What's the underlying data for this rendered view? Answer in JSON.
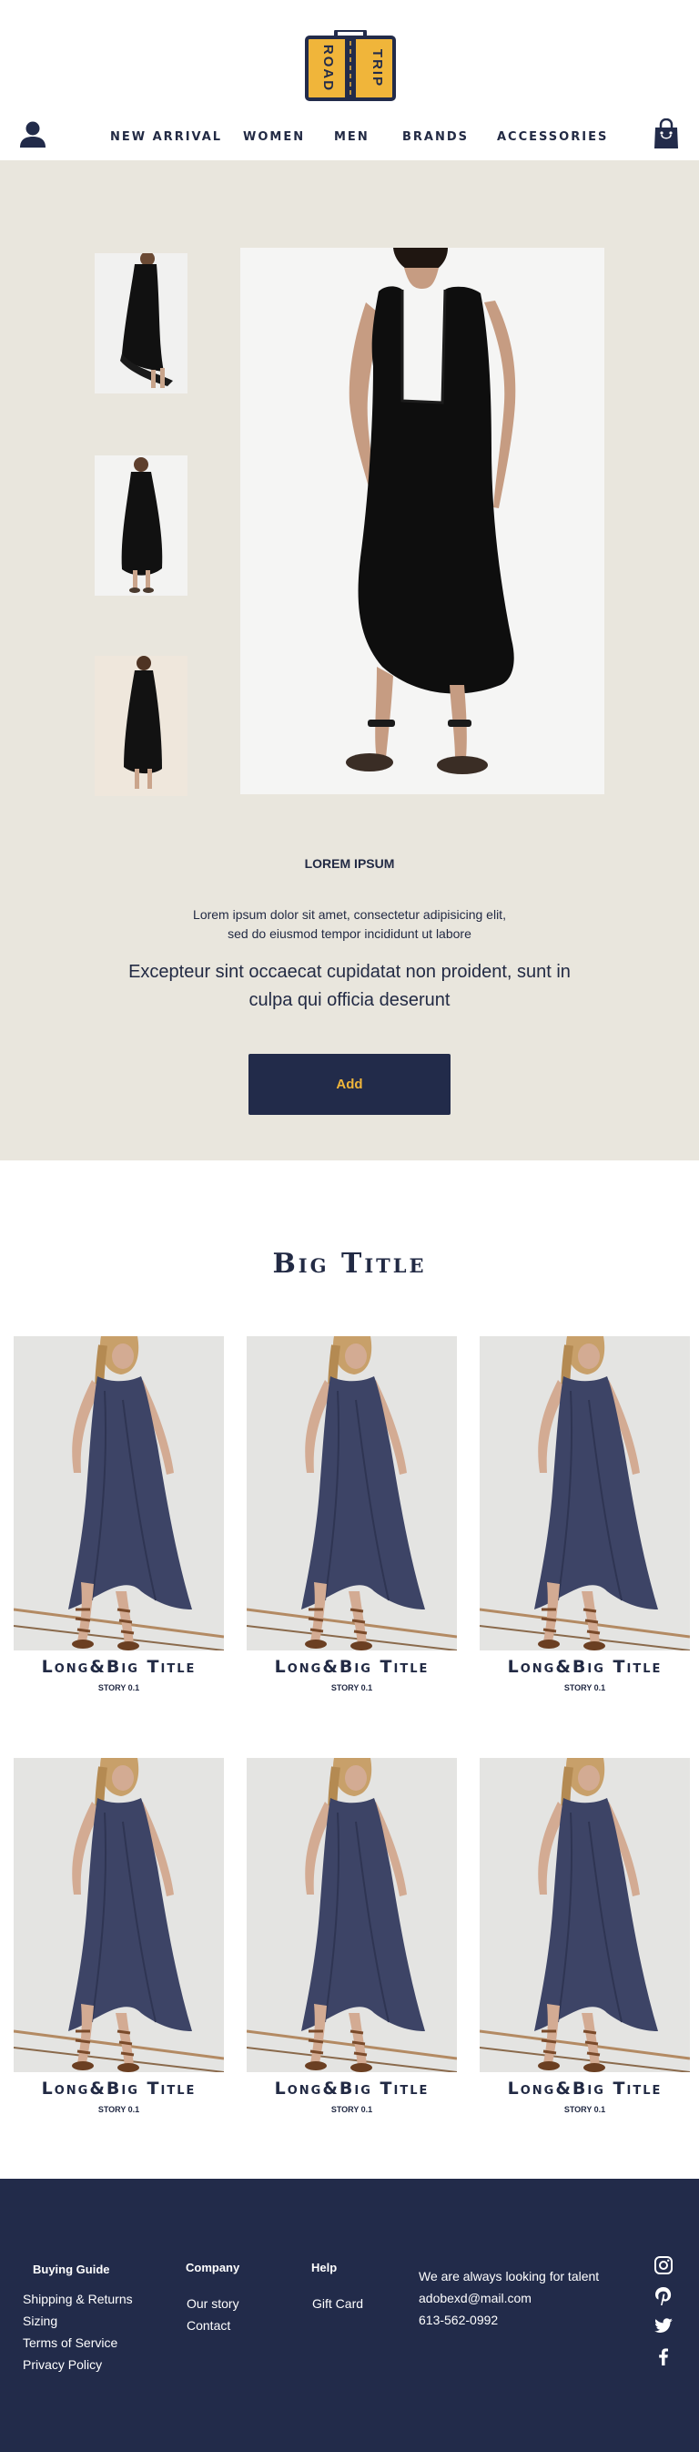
{
  "header": {
    "logo": {
      "line1": "ROAD",
      "line2": "TRIP"
    },
    "nav": [
      {
        "label": "NEW ARRIVAL"
      },
      {
        "label": "WOMEN"
      },
      {
        "label": "MEN"
      },
      {
        "label": "BRANDS"
      },
      {
        "label": "ACCESSORIES"
      }
    ]
  },
  "product": {
    "title": "LOREM IPSUM",
    "description_line1": "Lorem ipsum dolor sit amet, consectetur adipisicing elit,",
    "description_line2": "sed do eiusmod tempor incididunt ut labore",
    "lead_line1": "Excepteur sint occaecat cupidatat non proident, sunt in",
    "lead_line2": "culpa qui officia deserunt",
    "add_label": "Add"
  },
  "stories": {
    "title": "Big Title",
    "cards": [
      {
        "title": "Long&Big Title",
        "subtitle": "STORY 0.1"
      },
      {
        "title": "Long&Big Title",
        "subtitle": "STORY 0.1"
      },
      {
        "title": "Long&Big Title",
        "subtitle": "STORY 0.1"
      },
      {
        "title": "Long&Big Title",
        "subtitle": "STORY 0.1"
      },
      {
        "title": "Long&Big Title",
        "subtitle": "STORY 0.1"
      },
      {
        "title": "Long&Big Title",
        "subtitle": "STORY 0.1"
      }
    ]
  },
  "footer": {
    "buying_guide": {
      "heading": "Buying Guide",
      "links": [
        "Shipping & Returns",
        "Sizing",
        "Terms of Service",
        "Privacy Policy"
      ]
    },
    "company": {
      "heading": "Company",
      "links": [
        "Our story",
        "Contact"
      ]
    },
    "help": {
      "heading": "Help",
      "links": [
        "Gift Card"
      ]
    },
    "contact": {
      "talent": "We are always looking for talent",
      "email": "adobexd@mail.com",
      "phone": "613-562-0992"
    },
    "social": [
      "instagram-icon",
      "pinterest-icon",
      "twitter-icon",
      "facebook-icon"
    ]
  },
  "colors": {
    "navy": "#222b4a",
    "accent": "#f0b53a",
    "beige": "#e9e6dd"
  }
}
